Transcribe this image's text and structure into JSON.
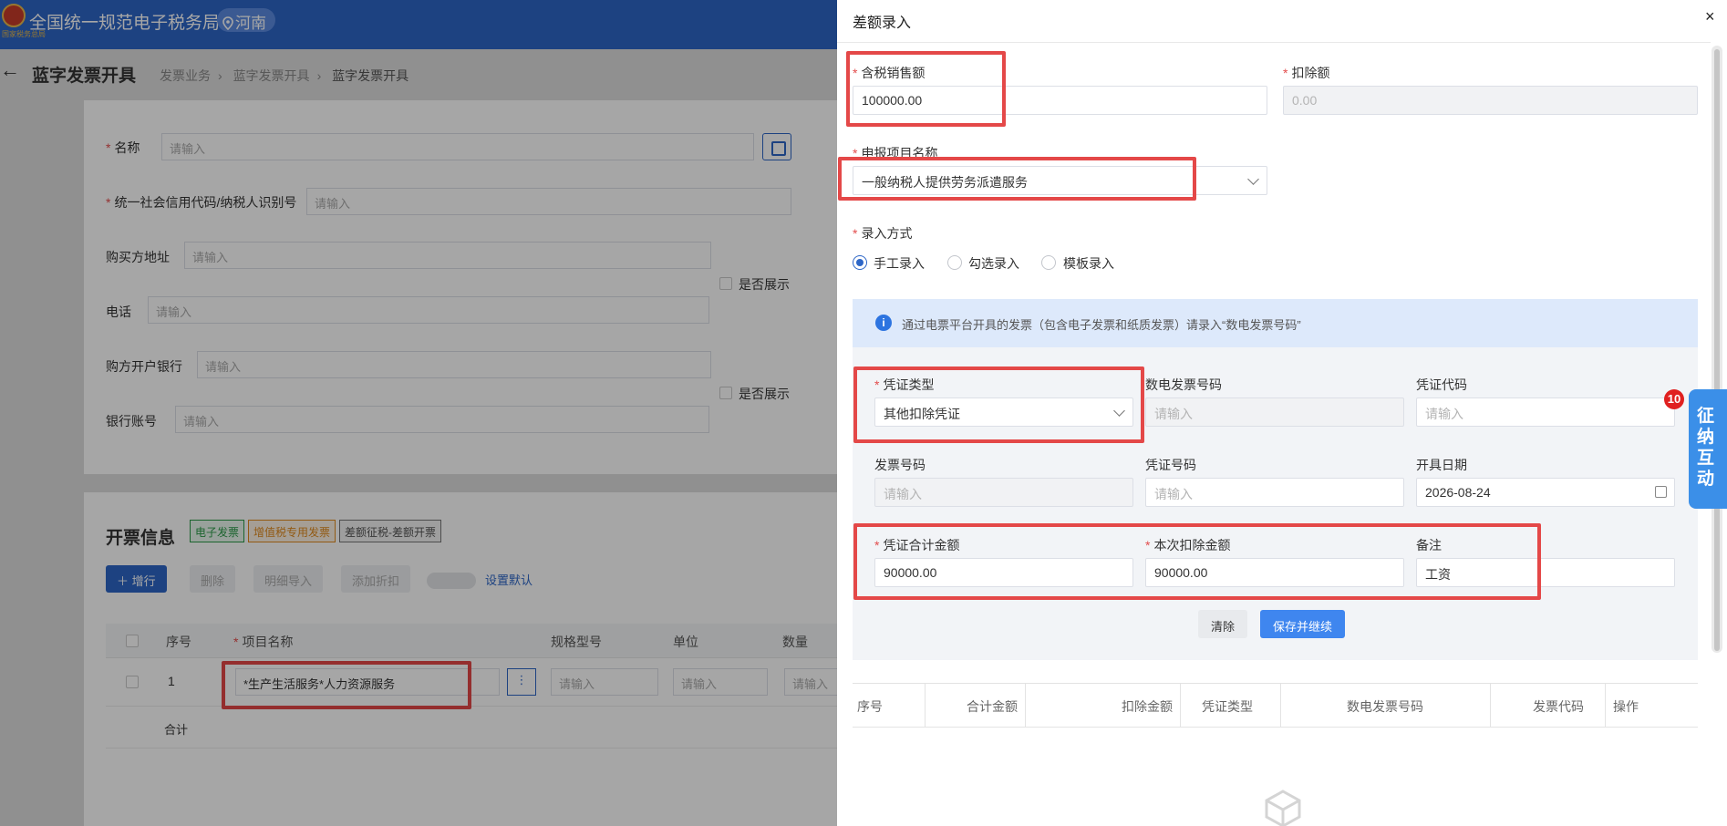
{
  "header": {
    "app_title": "全国统一规范电子税务局",
    "region": "河南",
    "emblem_text": "国家税务总局"
  },
  "page": {
    "back_icon": "back-arrow-icon",
    "title": "蓝字发票开具",
    "breadcrumbs": [
      "发票业务",
      "蓝字发票开具",
      "蓝字发票开具"
    ]
  },
  "buyer_form": {
    "name_label": "名称",
    "credit_code_label": "统一社会信用代码/纳税人识别号",
    "address_label": "购买方地址",
    "phone_label": "电话",
    "bank_label": "购方开户银行",
    "account_label": "银行账号",
    "placeholder": "请输入",
    "show_label_1": "是否展示",
    "show_label_2": "是否展示"
  },
  "invoice_section": {
    "title": "开票信息",
    "tags": [
      "电子发票",
      "增值税专用发票",
      "差额征税-差额开票"
    ],
    "buttons": {
      "add_row": "＋ 增行",
      "delete": "删除",
      "detail_import": "明细导入",
      "add_discount": "添加折扣"
    },
    "set_default": "设置默认",
    "columns": [
      "序号",
      "项目名称",
      "规格型号",
      "单位",
      "数量"
    ],
    "row": {
      "index": "1",
      "item_name": "*生产生活服务*人力资源服务",
      "placeholder": "请输入"
    },
    "total_label": "合计"
  },
  "drawer": {
    "title": "差额录入",
    "close": "×",
    "taxable_sales_label": "含税销售额",
    "taxable_sales_value": "100000.00",
    "deduction_label": "扣除额",
    "deduction_value": "0.00",
    "project_name_label": "申报项目名称",
    "project_name_value": "一般纳税人提供劳务派遣服务",
    "entry_method_label": "录入方式",
    "entry_methods": [
      "手工录入",
      "勾选录入",
      "模板录入"
    ],
    "selected_method": "手工录入",
    "info_text": "通过电票平台开具的发票（包含电子发票和纸质发票）请录入“数电发票号码”",
    "voucher_type_label": "凭证类型",
    "voucher_type_value": "其他扣除凭证",
    "digital_invoice_no_label": "数电发票号码",
    "voucher_code_label": "凭证代码",
    "invoice_no_label": "发票号码",
    "voucher_no_label": "凭证号码",
    "issue_date_label": "开具日期",
    "issue_date_value": "2026-08-24",
    "voucher_total_label": "凭证合计金额",
    "voucher_total_value": "90000.00",
    "current_deduction_label": "本次扣除金额",
    "current_deduction_value": "90000.00",
    "remark_label": "备注",
    "remark_value": "工资",
    "placeholder": "请输入",
    "clear_button": "清除",
    "save_button": "保存并继续",
    "table_columns": [
      "序号",
      "合计金额",
      "扣除金额",
      "凭证类型",
      "数电发票号码",
      "发票代码",
      "操作"
    ]
  },
  "float_widget": {
    "label": "征纳互动",
    "badge": "10"
  },
  "colors": {
    "brand_blue": "#2d66c7",
    "annotation_red": "#e44848",
    "info_bg": "#dde9fb"
  }
}
